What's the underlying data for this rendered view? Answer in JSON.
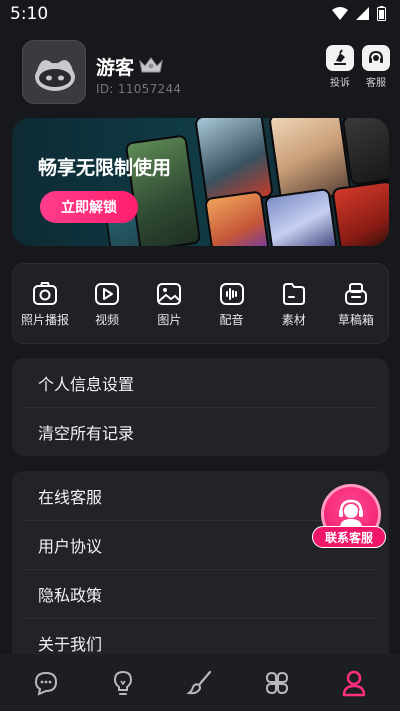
{
  "status_bar": {
    "time": "5:10"
  },
  "profile": {
    "username": "游客",
    "user_id": "ID: 11057244"
  },
  "header_actions": {
    "complaint_label": "投诉",
    "service_label": "客服"
  },
  "banner": {
    "title": "畅享无限制使用",
    "button_label": "立即解锁"
  },
  "tools": [
    {
      "label": "照片播报",
      "icon": "camera-icon"
    },
    {
      "label": "视频",
      "icon": "video-icon"
    },
    {
      "label": "图片",
      "icon": "image-icon"
    },
    {
      "label": "配音",
      "icon": "audio-icon"
    },
    {
      "label": "素材",
      "icon": "folder-icon"
    },
    {
      "label": "草稿箱",
      "icon": "drafts-icon"
    }
  ],
  "menu_group1": [
    "个人信息设置",
    "清空所有记录"
  ],
  "menu_group2": [
    "在线客服",
    "用户协议",
    "隐私政策",
    "关于我们"
  ],
  "float_support": {
    "label": "联系客服"
  },
  "bottom_nav": {
    "items": [
      "chat-icon",
      "bulb-icon",
      "brush-icon",
      "apps-icon",
      "user-icon"
    ],
    "active_index": 4,
    "active_color": "#ff2e7e",
    "inactive_color": "#b8b9be"
  },
  "colors": {
    "accent": "#ff2e7e",
    "background": "#17181c",
    "card": "#222328"
  }
}
